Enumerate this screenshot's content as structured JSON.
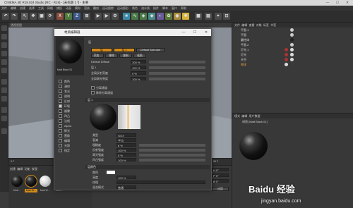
{
  "window": {
    "title": "CINEMA 4D R19.024 Studio (RC - R19) - [未标题 1 *] - 主要"
  },
  "menubar": {
    "items": [
      "文件",
      "编辑",
      "创建",
      "选择",
      "工具",
      "网格",
      "捕捉",
      "动画",
      "模拟",
      "渲染",
      "雕刻",
      "运动跟踪",
      "运动图形",
      "角色",
      "流水线",
      "插件",
      "脚本",
      "窗口",
      "帮助"
    ]
  },
  "toolbar": {
    "axis_labels": [
      "X",
      "Y",
      "Z"
    ]
  },
  "viewport": {
    "header": "透视视图",
    "grid_label": "网格间距 : 100 cm"
  },
  "timeline": {
    "frame_start": "0 F",
    "frame_end": "90 F"
  },
  "material_manager": {
    "menu": [
      "创建",
      "编辑",
      "功能",
      "纹理"
    ],
    "materials": [
      "Matt…",
      "Matt Bl…",
      "Matt W…",
      "Matt…"
    ]
  },
  "coords": {
    "rows": [
      {
        "axis": "X",
        "pos": "0 cm",
        "size": "0 cm",
        "rot": "H 0°"
      },
      {
        "axis": "Y",
        "pos": "0 cm",
        "size": "0 cm",
        "rot": "P 0°"
      },
      {
        "axis": "Z",
        "pos": "0 cm",
        "size": "0 cm",
        "rot": "B 0°"
      }
    ],
    "apply": "应用"
  },
  "object_manager": {
    "menu": [
      "文件",
      "编辑",
      "查看",
      "对象",
      "标签",
      "书签"
    ],
    "objects": [
      "平面.1",
      "平面",
      "圆柱体",
      "平面.2",
      "灯光.1",
      "灯光",
      "天空",
      "物体"
    ]
  },
  "attribute_manager": {
    "tabs": [
      "模式",
      "编辑",
      "用户数据"
    ],
    "material_label": "材质 [Matt Black 01]"
  },
  "material_editor": {
    "title": "材质编辑器",
    "material_name": "Matt Black 01",
    "layer_label": "层",
    "mode_tabs": [
      "层",
      "层 1",
      "Default Specular"
    ],
    "layer_buttons": [
      "添加...",
      "移除",
      "复制",
      "粘贴"
    ],
    "channels": [
      "颜色",
      "漫射",
      "发光",
      "透明",
      "反射",
      "环境",
      "烟雾",
      "凹凸",
      "法线",
      "Alpha",
      "辉光",
      "置换",
      "编辑",
      "光照",
      "指定"
    ],
    "rows": [
      {
        "label": "Default Diffuse",
        "value": "100 %"
      },
      {
        "label": "层 1",
        "value": "100 %"
      },
      {
        "label": "全局反射亮度",
        "value": "0 %"
      },
      {
        "label": "全局高光亮度",
        "value": "100 %"
      }
    ],
    "checks": [
      "分离通道",
      "移除分离通道"
    ],
    "layer_section": "层 1",
    "props": [
      {
        "label": "类型",
        "value": "GGX"
      },
      {
        "label": "衰减",
        "value": "平均"
      },
      {
        "label": "粗糙度",
        "value": "8 %"
      },
      {
        "label": "反射强度",
        "value": "100 %"
      },
      {
        "label": "高光强度",
        "value": "0 %"
      },
      {
        "label": "凹凸强度",
        "value": "100 %"
      }
    ],
    "color_section": "层颜色",
    "color_props": [
      {
        "label": "颜色"
      },
      {
        "label": "亮度",
        "value": "100 %"
      },
      {
        "label": "纹理"
      },
      {
        "label": "混合模式",
        "value": "普通"
      }
    ]
  },
  "watermark": {
    "line1": "Baidu 经验",
    "line2": "jingyan.baidu.com"
  }
}
